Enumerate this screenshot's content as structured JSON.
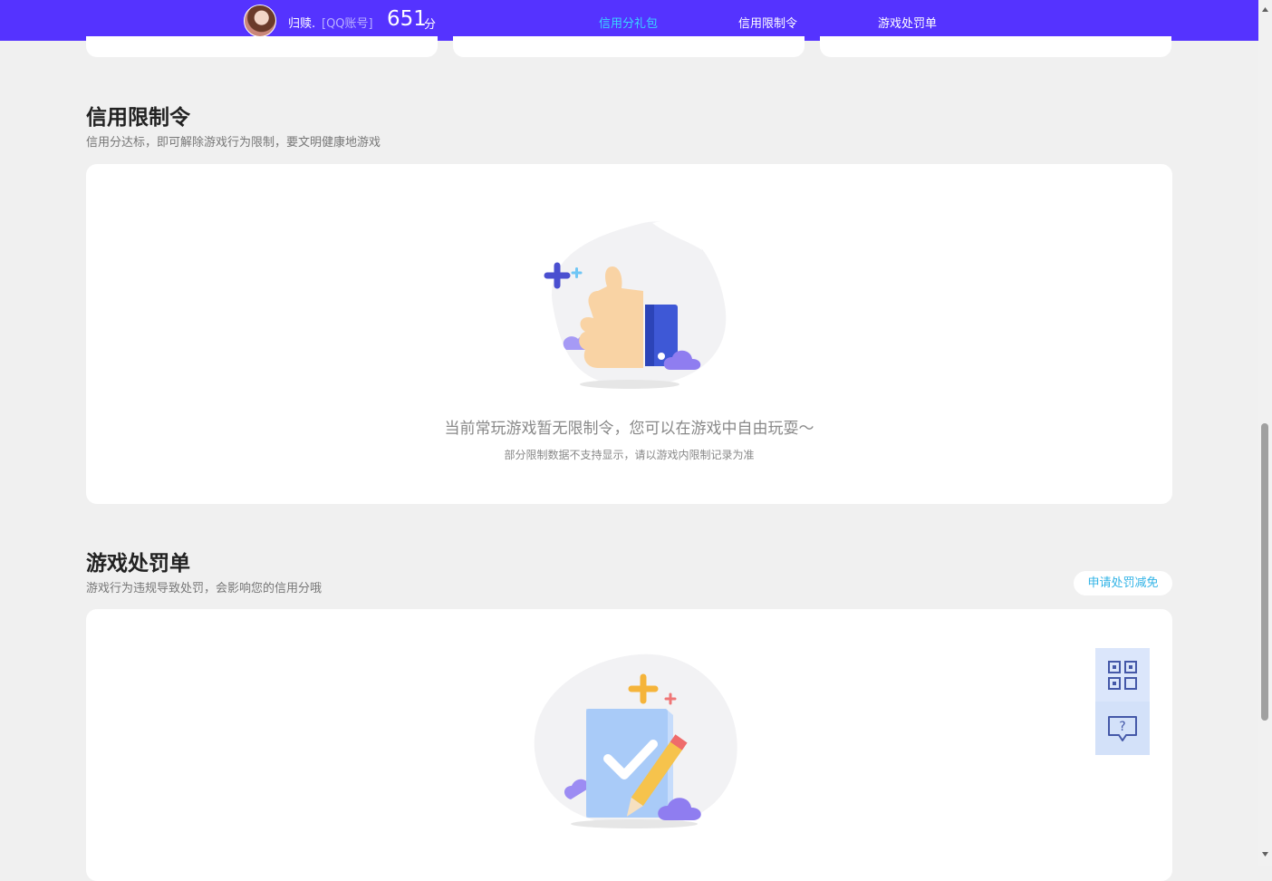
{
  "header": {
    "username": "归赎.",
    "account_tag": "[QQ账号]",
    "score": "651",
    "score_unit": "分",
    "tabs": [
      {
        "label": "信用分礼包",
        "active": true
      },
      {
        "label": "信用限制令",
        "active": false
      },
      {
        "label": "游戏处罚单",
        "active": false
      }
    ]
  },
  "restriction": {
    "title": "信用限制令",
    "subtitle": "信用分达标，即可解除游戏行为限制，要文明健康地游戏",
    "empty_main": "当前常玩游戏暂无限制令，您可以在游戏中自由玩耍～",
    "empty_sub": "部分限制数据不支持显示，请以游戏内限制记录为准"
  },
  "punishment": {
    "title": "游戏处罚单",
    "subtitle": "游戏行为违规导致处罚，会影响您的信用分哦",
    "apply_label": "申请处罚减免"
  },
  "floating": {
    "icons": [
      "qr-code-icon",
      "help-chat-icon"
    ]
  },
  "colors": {
    "topbar": "#5533ff",
    "accent": "#39d7ff",
    "link": "#31b3e6"
  }
}
